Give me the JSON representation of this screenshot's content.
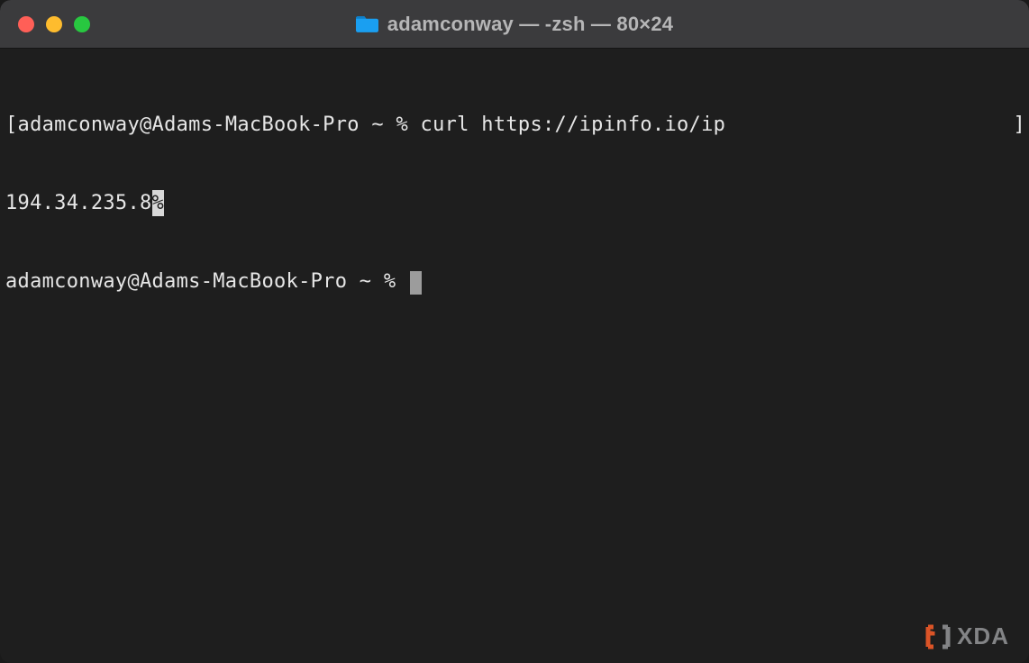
{
  "window": {
    "title": "adamconway — -zsh — 80×24"
  },
  "terminal": {
    "line1_open_bracket": "[",
    "line1_prompt": "adamconway@Adams-MacBook-Pro ~ % ",
    "line1_command": "curl https://ipinfo.io/ip",
    "line1_close_bracket": "]",
    "line2_output": "194.34.235.8",
    "line2_percent": "%",
    "line3_prompt": "adamconway@Adams-MacBook-Pro ~ % "
  },
  "watermark": {
    "text": "XDA"
  }
}
